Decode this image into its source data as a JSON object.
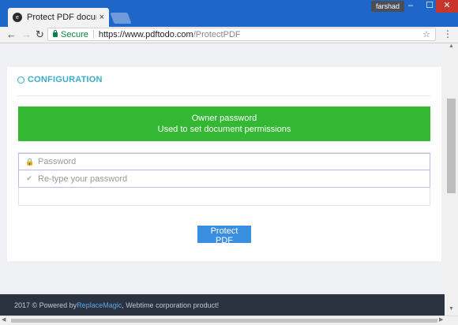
{
  "browser": {
    "tab_title": "Protect PDF documents",
    "tab_close": "×",
    "user_badge": "farshad",
    "secure_label": "Secure",
    "url_host": "https://www.pdftodo.com",
    "url_path": "/ProtectPDF",
    "back": "←",
    "forward": "→",
    "reload": "↻",
    "star": "☆",
    "menu": "⋮",
    "win_min": "–",
    "win_max": "☐",
    "win_close": "✕"
  },
  "config": {
    "title": "CONFIGURATION",
    "banner_line1": "Owner password",
    "banner_line2": "Used to set document permissions",
    "password_placeholder": "Password",
    "retype_placeholder": "Re-type your password",
    "submit_label": "Protect PDF"
  },
  "footer": {
    "prefix": "2017 © Powered by ",
    "brand": "ReplaceMagic",
    "suffix": ", Webtime corporation product!"
  },
  "colors": {
    "banner": "#34b833",
    "accent": "#3dabc7",
    "button": "#3a8ee0",
    "footer_bg": "#2b3340",
    "brand_link": "#5aa7e8"
  },
  "icons": {
    "password": "lock-icon",
    "retype": "check-icon",
    "header": "gear-icon"
  }
}
